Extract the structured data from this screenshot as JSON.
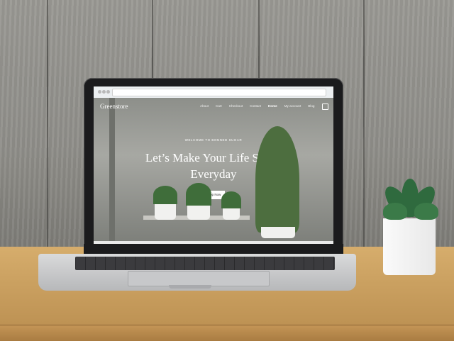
{
  "browser": {
    "url": ""
  },
  "site": {
    "brand": "Greenstore",
    "nav": [
      {
        "label": "About"
      },
      {
        "label": "Cart"
      },
      {
        "label": "Checkout"
      },
      {
        "label": "Contact"
      },
      {
        "label": "Home",
        "active": true
      },
      {
        "label": "My account"
      },
      {
        "label": "Blog"
      }
    ],
    "hero": {
      "eyebrow": "WELCOME TO BONNED SUGAR",
      "title_line1": "Let’s Make Your Life Sweet",
      "title_line2": "Everyday",
      "cta": "Shop Now"
    }
  },
  "colors": {
    "accent": "#ffffff",
    "hero_overlay": "#8d8f8a"
  }
}
